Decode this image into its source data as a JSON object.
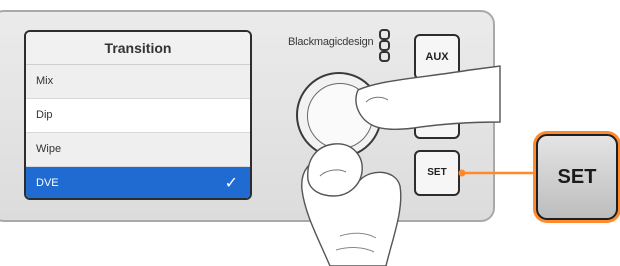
{
  "lcd": {
    "title": "Transition",
    "items": [
      {
        "label": "Mix",
        "selected": false
      },
      {
        "label": "Dip",
        "selected": false
      },
      {
        "label": "Wipe",
        "selected": false
      },
      {
        "label": "DVE",
        "selected": true
      }
    ],
    "selected_marker": "✓",
    "highlight_color": "#1f6bd1"
  },
  "brand": {
    "logo_text": "Blackmagicdesign"
  },
  "buttons": {
    "aux_label": "AUX",
    "set_label": "SET"
  },
  "callout": {
    "label": "SET",
    "accent_color": "#ff8a2d"
  }
}
